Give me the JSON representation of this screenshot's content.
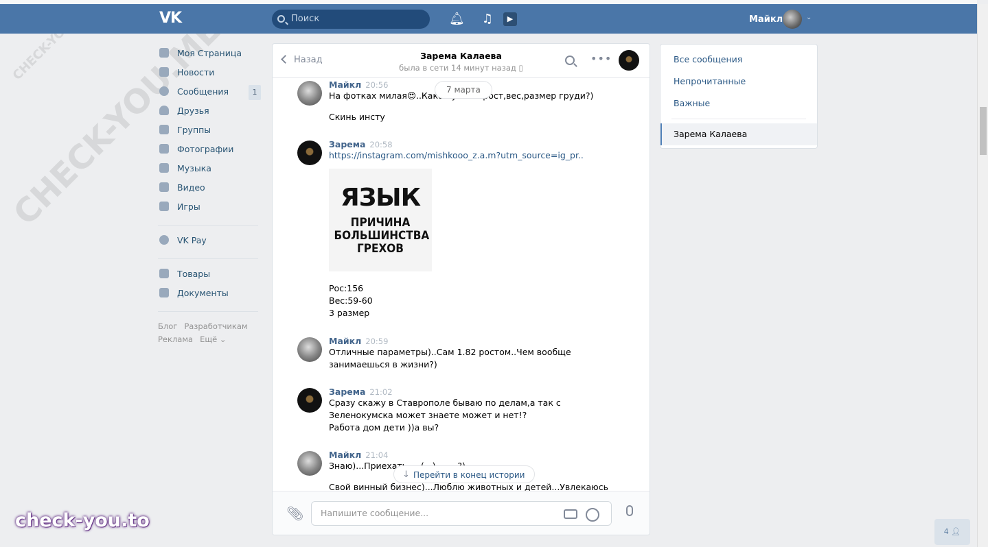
{
  "header": {
    "logo": "VK",
    "search_placeholder": "Поиск",
    "user_name": "Майкл",
    "icons": [
      "bell-icon",
      "music-icon",
      "video-icon"
    ]
  },
  "sidebar": {
    "items": [
      {
        "label": "Моя Страница",
        "icon": "home-icon"
      },
      {
        "label": "Новости",
        "icon": "news-icon"
      },
      {
        "label": "Сообщения",
        "icon": "messages-icon",
        "badge": "1"
      },
      {
        "label": "Друзья",
        "icon": "friends-icon"
      },
      {
        "label": "Группы",
        "icon": "groups-icon"
      },
      {
        "label": "Фотографии",
        "icon": "camera-icon"
      },
      {
        "label": "Музыка",
        "icon": "music-icon"
      },
      {
        "label": "Видео",
        "icon": "video-icon"
      },
      {
        "label": "Игры",
        "icon": "games-icon"
      }
    ],
    "vkpay": "VK Pay",
    "extra": [
      {
        "label": "Товары",
        "icon": "bag-icon"
      },
      {
        "label": "Документы",
        "icon": "document-icon"
      }
    ],
    "footer": [
      "Блог",
      "Разработчикам",
      "Реклама",
      "Ещё ⌄"
    ]
  },
  "chat": {
    "back_label": "Назад",
    "peer_name": "Зарема Калаева",
    "peer_status": "была в сети 14 минут назад",
    "date_pill": "7 марта",
    "messages": [
      {
        "author": "Майкл",
        "time": "20:56",
        "lines": [
          "На фотках милая😍..Какой у тебя рост,вес,размер груди?)",
          "",
          "Скинь инсту"
        ]
      },
      {
        "author": "Зарема",
        "time": "20:58",
        "link": "https://instagram.com/mishkooo_z.a.m?utm_source=ig_pr..",
        "image_text": [
          "ЯЗЫК",
          "ПРИЧИНА",
          "БОЛЬШИНСТВА",
          "ГРЕХОВ"
        ],
        "lines": [
          "Рос:156",
          "Вес:59-60",
          "3 размер"
        ]
      },
      {
        "author": "Майкл",
        "time": "20:59",
        "lines": [
          "Отличные параметры)..Сам 1.82 ростом..Чем вообще",
          "занимаешься в жизни?)"
        ]
      },
      {
        "author": "Зарема",
        "time": "21:02",
        "lines": [
          "Сразу скажу в Ставрополе бываю по делам,а так с",
          "Зеленокумска может знаете может и нет!?",
          "Работа дом дети ))а вы?"
        ]
      },
      {
        "author": "Майкл",
        "time": "21:04",
        "lines": [
          "Знаю)...Приехать ...  (...) ...  ...?)",
          "",
          "Свой винный бизнес)...Люблю животных и детей...Увлекаюсь"
        ]
      }
    ],
    "jump_to_end": "Перейти в конец истории",
    "compose_placeholder": "Напишите сообщение..."
  },
  "filters": {
    "items": [
      "Все сообщения",
      "Непрочитанные",
      "Важные"
    ],
    "active_chat": "Зарема Калаева"
  },
  "fab_label": "4",
  "watermarks": {
    "large": "CHECK-YOU.ME",
    "small": "CHECK-YOU.ME",
    "bottom": "check-you.to"
  }
}
